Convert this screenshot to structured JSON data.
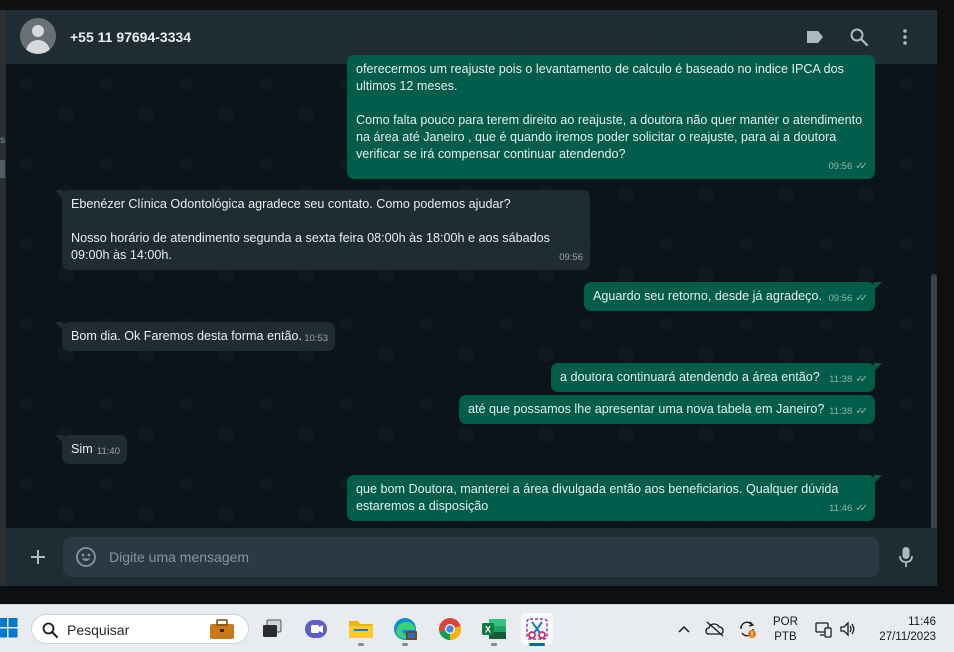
{
  "header": {
    "contact_name": "+55 11 97694-3334",
    "icons": [
      "label-icon",
      "search-icon",
      "menu-icon"
    ]
  },
  "messages": [
    {
      "direction": "out",
      "text": "oferecermos um reajuste pois o levantamento de calculo é baseado no indice IPCA dos ultimos 12 meses.\n\nComo falta pouco para terem direito ao reajuste, a doutora não quer manter o atendimento na área até Janeiro , que é quando iremos poder solicitar o reajuste, para ai a doutora verificar se irá compensar continuar atendendo?",
      "time": "09:56"
    },
    {
      "direction": "in",
      "text": "Ebenézer Clínica Odontológica agradece seu contato. Como podemos ajudar?\n\nNosso horário de atendimento segunda a sexta feira 08:00h às 18:00h e aos sábados 09:00h às 14:00h.",
      "time": "09:56"
    },
    {
      "direction": "out",
      "text": "Aguardo seu retorno, desde já agradeço.",
      "time": "09:56"
    },
    {
      "direction": "in",
      "text": "Bom dia. Ok Faremos desta forma então.",
      "time": "10:53"
    },
    {
      "direction": "out",
      "text": "a doutora continuará atendendo a área então?",
      "time": "11:38"
    },
    {
      "direction": "out",
      "text": "até que possamos lhe apresentar uma nova tabela em Janeiro?",
      "time": "11:38"
    },
    {
      "direction": "in",
      "text": "Sim",
      "time": "11:40"
    },
    {
      "direction": "out",
      "text": "que bom Doutora, manterei a área divulgada então aos beneficiarios. Qualquer dúvida estaremos a disposição",
      "time": "11:46"
    }
  ],
  "composer": {
    "placeholder": "Digite uma mensagem"
  },
  "taskbar": {
    "search_label": "Pesquisar",
    "apps": [
      "task-view",
      "teams",
      "file-explorer",
      "edge",
      "chrome",
      "excel",
      "snipping-tool"
    ],
    "active_app": "snipping-tool",
    "lang_line1": "POR",
    "lang_line2": "PTB",
    "time": "11:46",
    "date": "27/11/2023"
  },
  "colors": {
    "outgoing_bubble": "#005c4b",
    "incoming_bubble": "#202c33",
    "chat_bg": "#0b141a",
    "header_bg": "#202c33"
  }
}
